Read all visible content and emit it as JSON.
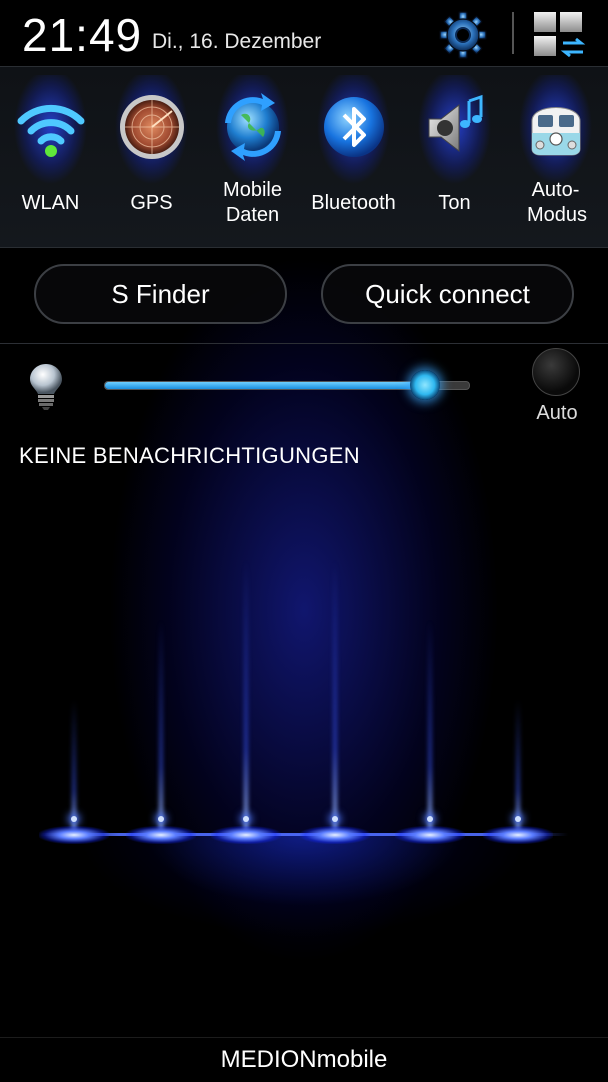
{
  "status_bar": {
    "time": "21:49",
    "date": "Di., 16. Dezember",
    "settings_icon": "gear-icon",
    "notifications_toggle_icon": "grid-switch-icon"
  },
  "quick_settings": [
    {
      "id": "wlan",
      "label": "WLAN",
      "icon": "wifi-icon",
      "active": true
    },
    {
      "id": "gps",
      "label": "GPS",
      "icon": "radar-icon",
      "active": true
    },
    {
      "id": "mobile-data",
      "label": "Mobile Daten",
      "icon": "globe-arrows-icon",
      "active": true
    },
    {
      "id": "bluetooth",
      "label": "Bluetooth",
      "icon": "bluetooth-icon",
      "active": true
    },
    {
      "id": "sound",
      "label": "Ton",
      "icon": "speaker-icon",
      "active": true
    },
    {
      "id": "car-mode",
      "label": "Auto-Modus",
      "icon": "vw-bus-icon",
      "active": true
    }
  ],
  "buttons": {
    "s_finder": "S Finder",
    "quick_connect": "Quick connect"
  },
  "brightness": {
    "level": 0.88,
    "auto_label": "Auto",
    "auto_enabled": false
  },
  "notifications": {
    "empty_text": "KEINE BENACHRICHTIGUNGEN"
  },
  "carrier": "MEDIONmobile",
  "colors": {
    "accent_blue": "#1a8fe0",
    "glow_blue": "#2846e6",
    "background": "#000000"
  }
}
